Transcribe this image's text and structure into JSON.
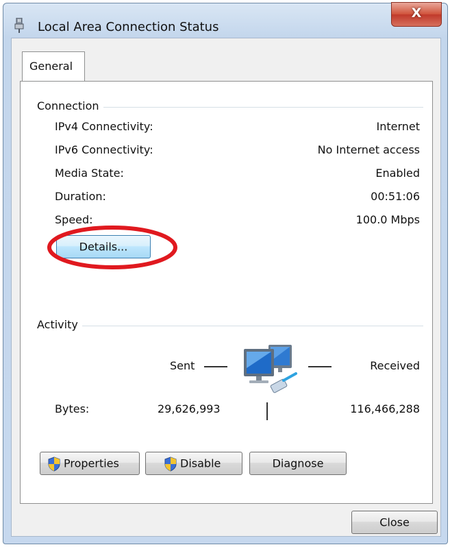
{
  "window": {
    "title": "Local Area Connection Status",
    "close_glyph": "X"
  },
  "tabs": [
    {
      "label": "General"
    }
  ],
  "connection": {
    "group_title": "Connection",
    "rows": [
      {
        "label": "IPv4 Connectivity:",
        "value": "Internet"
      },
      {
        "label": "IPv6 Connectivity:",
        "value": "No Internet access"
      },
      {
        "label": "Media State:",
        "value": "Enabled"
      },
      {
        "label": "Duration:",
        "value": "00:51:06"
      },
      {
        "label": "Speed:",
        "value": "100.0 Mbps"
      }
    ],
    "details_button": "Details...",
    "annotation_color": "#e0191f"
  },
  "activity": {
    "group_title": "Activity",
    "sent_label": "Sent",
    "received_label": "Received",
    "bytes_label": "Bytes:",
    "bytes_sent": "29,626,993",
    "bytes_received": "116,466,288",
    "icon": "network-computers-icon"
  },
  "buttons": {
    "properties": "Properties",
    "disable": "Disable",
    "diagnose": "Diagnose",
    "close": "Close"
  },
  "colors": {
    "accent": "#3c7fb1",
    "close_red": "#c0392b",
    "window_frame": "#c3d6ec"
  }
}
